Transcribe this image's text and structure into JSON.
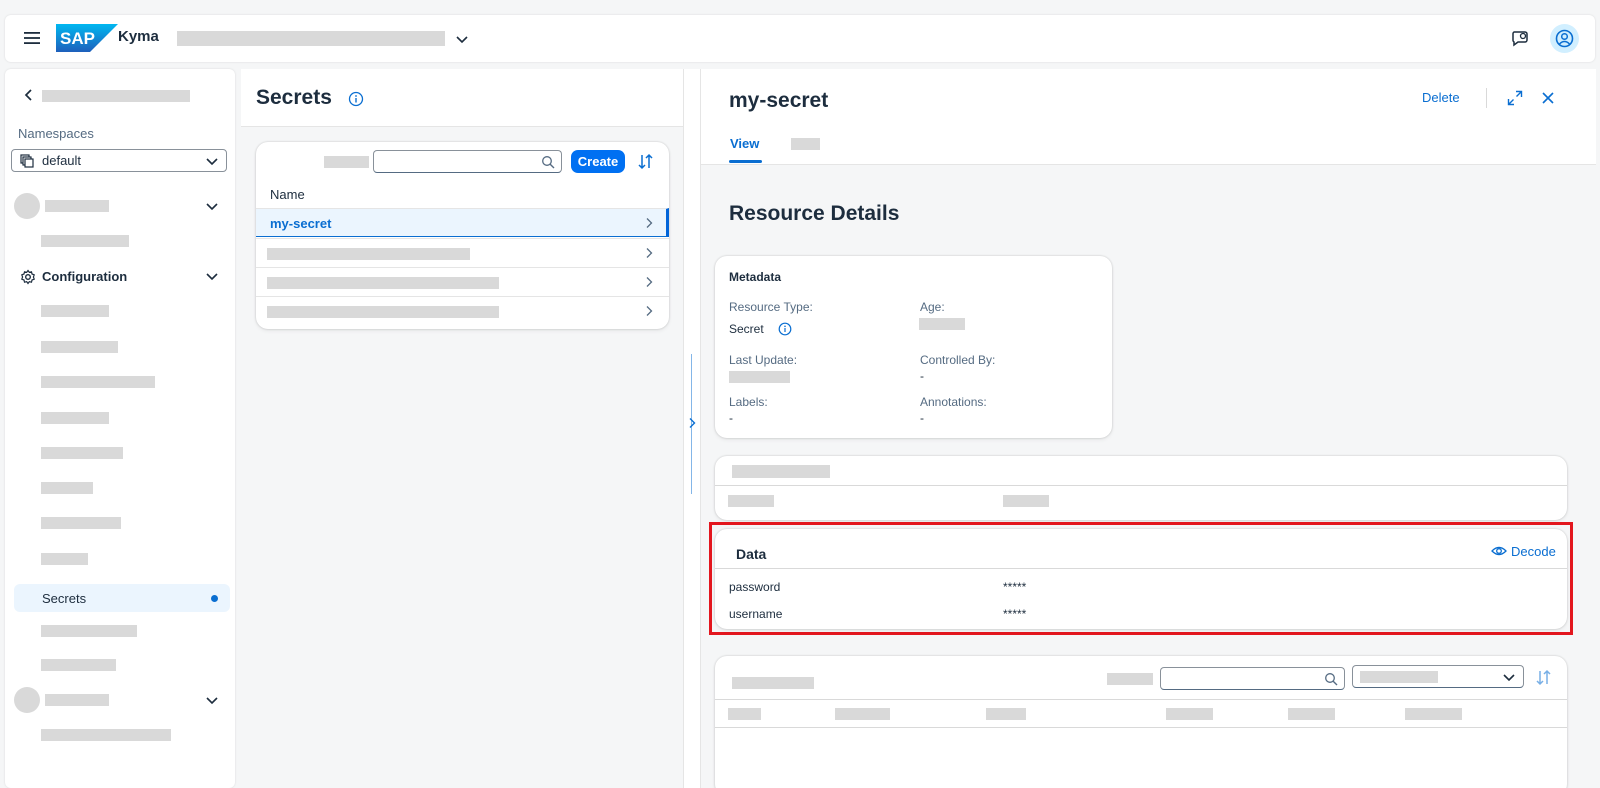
{
  "shell": {
    "product_name": "Kyma"
  },
  "sidebar": {
    "namespaces_label": "Namespaces",
    "namespace_value": "default",
    "configuration_label": "Configuration",
    "active_item_label": "Secrets"
  },
  "list": {
    "title": "Secrets",
    "create_label": "Create",
    "column_name": "Name",
    "selected_row": "my-secret"
  },
  "detail": {
    "title": "my-secret",
    "delete_label": "Delete",
    "tab_view": "View",
    "section_title": "Resource Details",
    "metadata": {
      "title": "Metadata",
      "resource_type_label": "Resource Type:",
      "resource_type_value": "Secret",
      "age_label": "Age:",
      "last_update_label": "Last Update:",
      "controlled_by_label": "Controlled By:",
      "controlled_by_value": "-",
      "labels_label": "Labels:",
      "labels_value": "-",
      "annotations_label": "Annotations:",
      "annotations_value": "-"
    },
    "data": {
      "title": "Data",
      "decode_label": "Decode",
      "rows": [
        {
          "key": "password",
          "value": "*****"
        },
        {
          "key": "username",
          "value": "*****"
        }
      ]
    }
  },
  "colors": {
    "accent": "#0a6ed1",
    "button": "#0070f2",
    "highlight_border": "#e3161e",
    "selected_row_bg": "#ebf5fe",
    "placeholder": "#d9d9d9"
  }
}
